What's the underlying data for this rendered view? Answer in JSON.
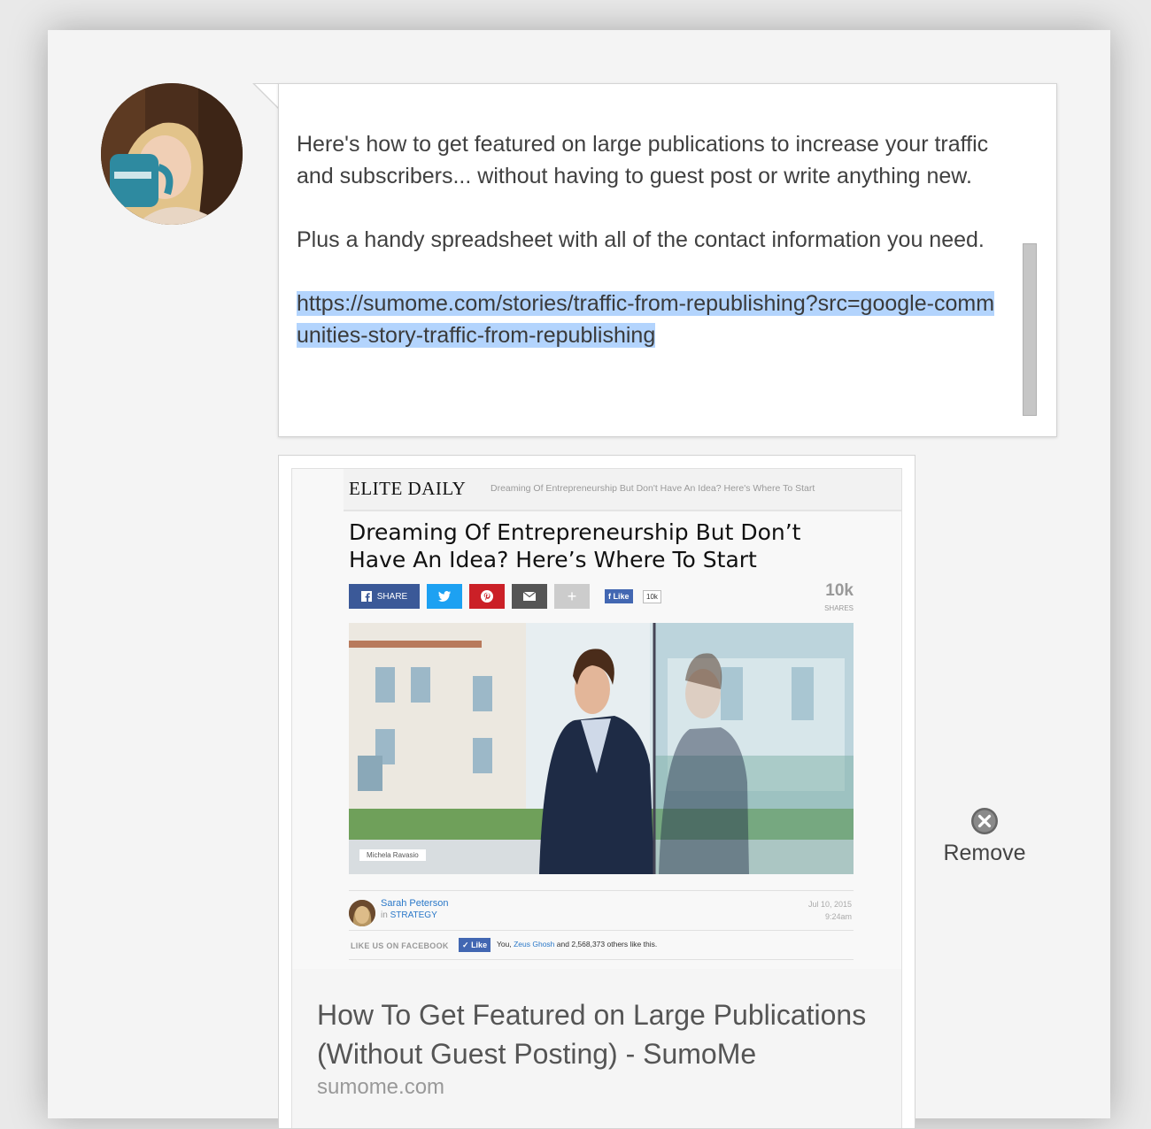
{
  "post": {
    "paragraphs": [
      "Here's how to get featured on large publications to increase your traffic and subscribers... without having to guest post or write anything new.",
      "Plus a handy spreadsheet with all of the contact information you need."
    ],
    "link": "https://sumome.com/stories/traffic-from-republishing?src=google-communities-story-traffic-from-republishing"
  },
  "preview": {
    "screenshot": {
      "logo": "ELITE DAILY",
      "breadcrumb": "Dreaming Of Entrepreneurship But Don't Have An Idea? Here's Where To Start",
      "headline": "Dreaming Of Entrepreneurship But Don’t Have An Idea? Here’s Where To Start",
      "share_label": "SHARE",
      "fb_like_label": "Like",
      "fb_like_count": "10k",
      "shares_count": "10k",
      "shares_label": "SHARES",
      "photo_credit": "Michela Ravasio",
      "author_name": "Sarah Peterson",
      "author_in": "in",
      "author_category": "STRATEGY",
      "date": "Jul 10, 2015",
      "time": "9:24am",
      "like_us_label": "LIKE US ON FACEBOOK",
      "like_button_label": "Like",
      "like_text_you": "You,",
      "like_text_name": "Zeus Ghosh",
      "like_text_rest": "and 2,568,373 others like this."
    },
    "title": "How To Get Featured on Large Publications (Without Guest Posting) - SumoMe",
    "domain": "sumome.com"
  },
  "remove": {
    "label": "Remove"
  },
  "colors": {
    "link_highlight": "#b3d4fd",
    "card_bg": "#f4f4f4",
    "facebook": "#3b5998",
    "twitter": "#1da1f2",
    "pinterest": "#cb2027"
  },
  "icons": [
    "avatar",
    "facebook-icon",
    "twitter-icon",
    "pinterest-icon",
    "email-icon",
    "plus-icon",
    "close-circle-icon"
  ]
}
